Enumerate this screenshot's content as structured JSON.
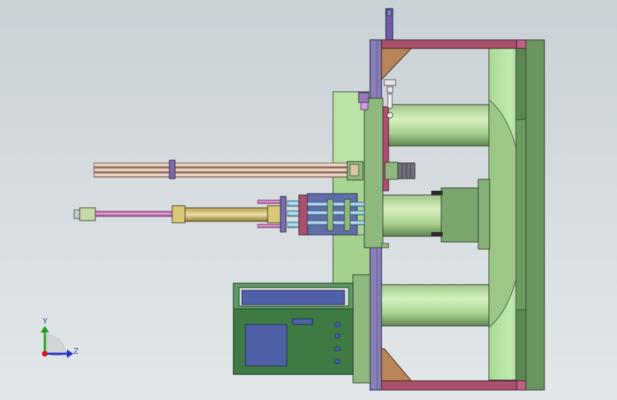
{
  "viewport": {
    "background_top": "#c9d1d6",
    "background_bottom": "#e3e7ea"
  },
  "triad": {
    "y_label": "Y",
    "z_label": "Z",
    "y_color": "#19a019",
    "z_color": "#2432c8",
    "x_color": "#d21e1e"
  },
  "colors": {
    "frame_purple": "#7a70a8",
    "frame_maroon": "#9a4a62",
    "green_light": "#b8e2a0",
    "green_dark": "#6f9a62",
    "brown": "#b07a4a",
    "copper": "#c09a80",
    "magenta": "#c060a8",
    "blue_panel": "#5560a6"
  }
}
